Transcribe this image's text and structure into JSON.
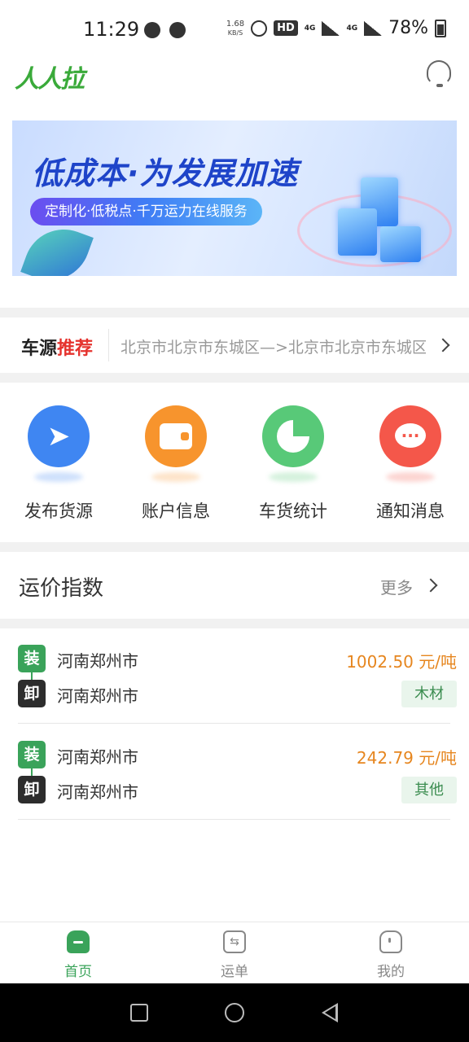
{
  "status_bar": {
    "time": "11:29",
    "net_speed": "1.68",
    "net_unit": "KB/S",
    "hd": "HD",
    "net_type": "4G",
    "battery": "78%"
  },
  "header": {
    "logo_text": "人人拉"
  },
  "banner": {
    "headline": "低成本·为发展加速",
    "subtitle": "定制化·低税点·千万运力在线服务"
  },
  "recommend": {
    "title_prefix": "车源",
    "title_highlight": "推荐",
    "route": "北京市北京市东城区—>北京市北京市东城区"
  },
  "quick_actions": [
    {
      "label": "发布货源",
      "icon": "paper-plane-icon",
      "color": "#3f86f2"
    },
    {
      "label": "账户信息",
      "icon": "wallet-icon",
      "color": "#f7942d"
    },
    {
      "label": "车货统计",
      "icon": "pie-chart-icon",
      "color": "#58c978"
    },
    {
      "label": "通知消息",
      "icon": "chat-bubble-icon",
      "color": "#f4574a"
    }
  ],
  "freight_index": {
    "title": "运价指数",
    "more": "更多",
    "items": [
      {
        "load_tag": "装",
        "unload_tag": "卸",
        "from": "河南郑州市",
        "to": "河南郑州市",
        "price": "1002.50 元/吨",
        "goods": "木材"
      },
      {
        "load_tag": "装",
        "unload_tag": "卸",
        "from": "河南郑州市",
        "to": "河南郑州市",
        "price": "242.79 元/吨",
        "goods": "其他"
      }
    ]
  },
  "tab_bar": {
    "tabs": [
      {
        "label": "首页",
        "active": true
      },
      {
        "label": "运单",
        "active": false
      },
      {
        "label": "我的",
        "active": false
      }
    ]
  },
  "colors": {
    "brand_green": "#3aa35a",
    "price_orange": "#e6861f",
    "hot_red": "#e5322d"
  }
}
